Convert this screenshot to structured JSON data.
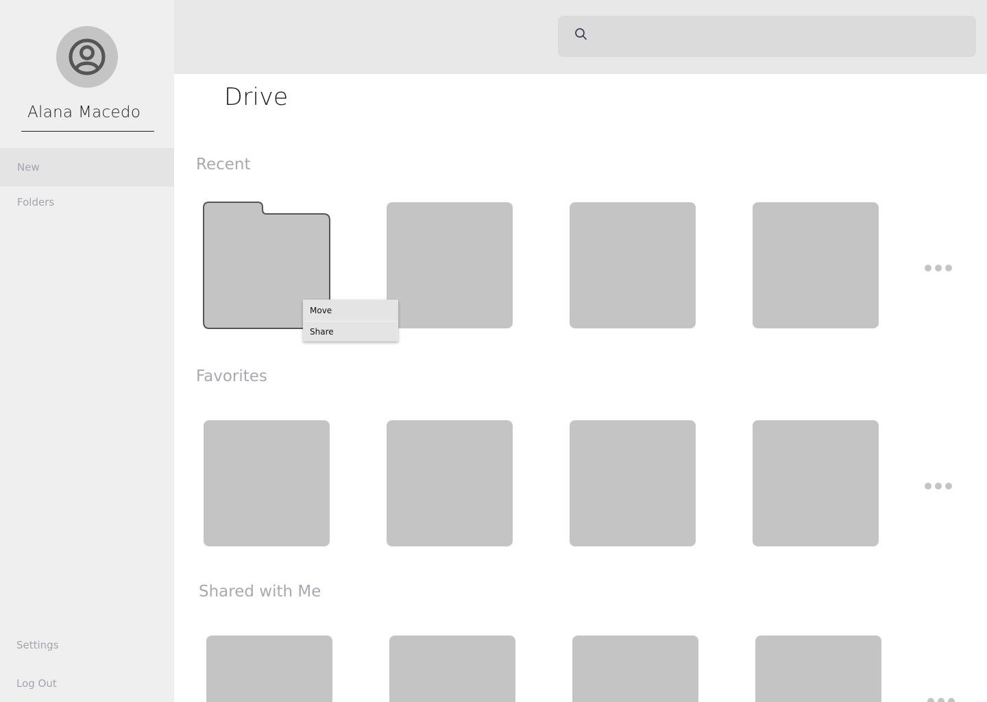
{
  "user": {
    "name": "Alana Macedo",
    "avatar_icon": "user-circle-icon"
  },
  "sidebar": {
    "items": [
      {
        "label": "New",
        "active": true
      },
      {
        "label": "Folders",
        "active": false
      }
    ],
    "bottom_items": [
      {
        "label": "Settings"
      },
      {
        "label": "Log Out"
      }
    ]
  },
  "search": {
    "icon": "search-icon",
    "placeholder": "",
    "value": ""
  },
  "main": {
    "title": "Drive",
    "sections": [
      {
        "title": "Recent"
      },
      {
        "title": "Favorites"
      },
      {
        "title": "Shared with Me"
      }
    ]
  },
  "context_menu": {
    "items": [
      {
        "label": "Move"
      },
      {
        "label": "Share"
      }
    ]
  },
  "colors": {
    "sidebar_bg": "#efefef",
    "active_nav_bg": "#e4e4e4",
    "topbar_bg": "#e9e8e9",
    "search_bg": "#dcdbdc",
    "tile": "#c4c4c4",
    "muted_text": "#a4a4ad"
  }
}
